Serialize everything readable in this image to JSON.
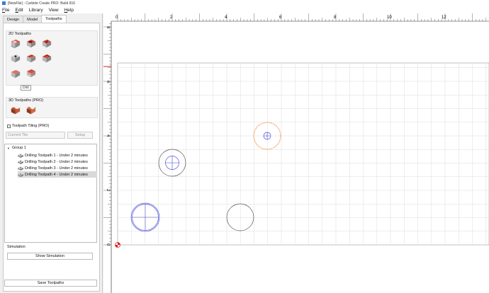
{
  "window": {
    "title": "[NewFile] - Carbide Create PRO: Build 816"
  },
  "menu": [
    {
      "key": "F",
      "rest": "ile"
    },
    {
      "key": "E",
      "rest": "dit"
    },
    {
      "key": "",
      "rest": "Library"
    },
    {
      "key": "",
      "rest": "View"
    },
    {
      "key": "H",
      "rest": "elp"
    }
  ],
  "tabs": {
    "design": "Design",
    "model": "Model",
    "toolpaths": "Toolpaths"
  },
  "toolpaths_2d": {
    "title": "2D Toolpaths",
    "tooltip": "Drill"
  },
  "toolpaths_3d": {
    "title": "3D Toolpaths (PRO)"
  },
  "tiling": {
    "label": "Toolpath Tiling (PRO)",
    "current_tile": "Current Tile",
    "setup": "Setup"
  },
  "tree": {
    "group": "Group 1",
    "items": [
      "Drilling Toolpath 1 - Under 2 minutes",
      "Drilling Toolpath 2 - Under 2 minutes",
      "Drilling Toolpath 3 - Under 2 minutes",
      "Drilling Toolpath 4 - Under 2 minutes"
    ]
  },
  "simulation": {
    "label": "Simulation",
    "show": "Show Simulation"
  },
  "save": {
    "label": "Save Toolpaths"
  },
  "ruler": {
    "x_ticks": [
      "0",
      "2",
      "4",
      "6",
      "8",
      "10",
      "12"
    ],
    "y_ticks": [
      "8",
      "6",
      "4",
      "2",
      "0"
    ]
  },
  "colors": {
    "accent": "#f57c20",
    "toolpath": "#5555dd",
    "origin": "#e02020",
    "grid": "#dcdcdc"
  }
}
